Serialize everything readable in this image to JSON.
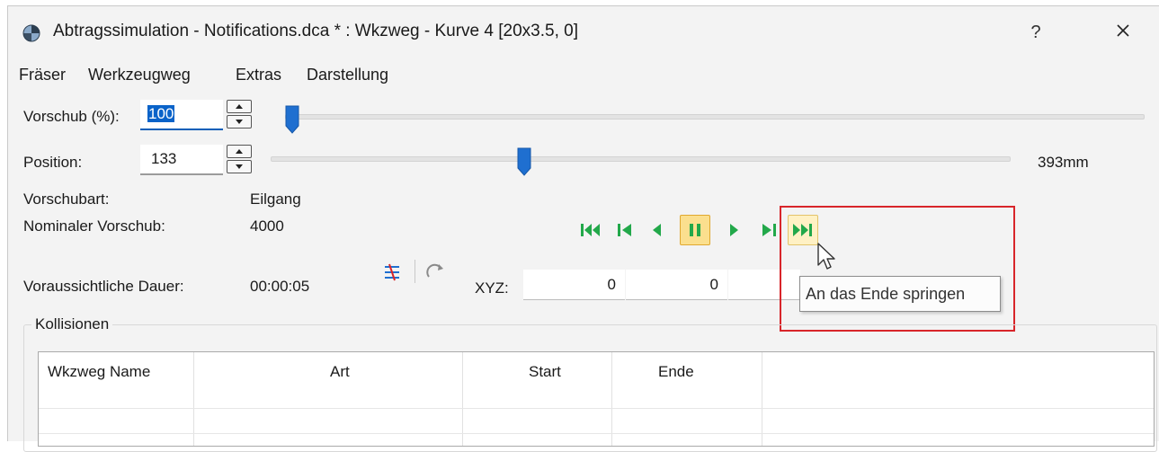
{
  "window": {
    "title": "Abtragssimulation - Notifications.dca * : Wkzweg - Kurve 4 [20x3.5, 0]",
    "help_label": "?",
    "icon": "app-globe-icon"
  },
  "menu": [
    "Fräser",
    "Werkzeugweg",
    "Extras",
    "Darstellung"
  ],
  "feed": {
    "label": "Vorschub (%):",
    "value": "100",
    "slider_fraction": 0.0
  },
  "position": {
    "label": "Position:",
    "value": "133",
    "slider_fraction": 0.34,
    "total": "393mm"
  },
  "info": {
    "feed_type_label": "Vorschubart:",
    "feed_type_value": "Eilgang",
    "nominal_label": "Nominaler Vorschub:",
    "nominal_value": "4000",
    "duration_label": "Voraussichtliche Dauer:",
    "duration_value": "00:00:05"
  },
  "playback": {
    "buttons": [
      "skip-to-start-icon",
      "step-back-icon",
      "play-backward-icon",
      "pause-icon",
      "play-forward-icon",
      "step-forward-icon",
      "skip-to-end-icon"
    ],
    "active": "pause-icon",
    "hovered": "skip-to-end-icon",
    "tooltip": "An das Ende springen",
    "color": "#22a84a",
    "highlight_color": "#d8252a"
  },
  "xyz": {
    "label": "XYZ:",
    "x": "0",
    "y": "0",
    "z": ""
  },
  "collisions": {
    "title": "Kollisionen",
    "columns": [
      "Wkzweg Name",
      "Art",
      "Start",
      "Ende"
    ]
  }
}
